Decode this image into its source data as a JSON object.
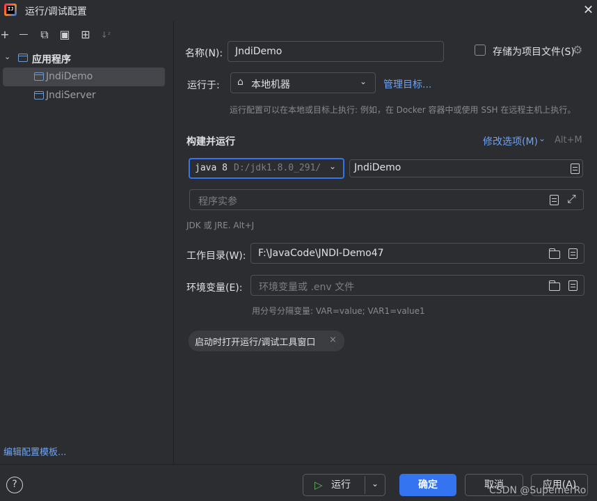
{
  "window": {
    "title": "运行/调试配置",
    "close_glyph": "✕"
  },
  "sidebar": {
    "toolbar": [
      {
        "name": "add-icon",
        "glyph": "+"
      },
      {
        "name": "remove-icon",
        "glyph": "—"
      },
      {
        "name": "copy-icon",
        "glyph": "⧉"
      },
      {
        "name": "save-icon",
        "glyph": "▣"
      },
      {
        "name": "new-folder-icon",
        "glyph": "⊞"
      },
      {
        "name": "sort-icon",
        "glyph": "↓ᶻ"
      }
    ],
    "group_label": "应用程序",
    "items": [
      {
        "label": "JndiDemo"
      },
      {
        "label": "JndiServer"
      }
    ],
    "edit_templates_link": "编辑配置模板..."
  },
  "form": {
    "name_label": "名称(N):",
    "name_value": "JndiDemo",
    "store_as_file_label": "存储为项目文件(S)",
    "run_on_label": "运行于:",
    "run_on_value": "本地机器",
    "manage_targets_link": "管理目标...",
    "run_on_hint": "运行配置可以在本地或目标上执行: 例如，在 Docker 容器中或使用 SSH 在远程主机上执行。",
    "build_run_section": "构建并运行",
    "modify_options_link": "修改选项(M)",
    "modify_options_shortcut": "Alt+M",
    "jdk_name": "java 8",
    "jdk_path": "D:/jdk1.8.0_291/",
    "main_class_value": "JndiDemo",
    "program_args_placeholder": "程序实参",
    "jdk_hint": "JDK 或 JRE. Alt+J",
    "workdir_label": "工作目录(W):",
    "workdir_value": "F:\\JavaCode\\JNDI-Demo47",
    "env_label": "环境变量(E):",
    "env_placeholder": "环境变量或 .env 文件",
    "env_hint": "用分号分隔变量: VAR=value; VAR1=value1",
    "chip_label": "启动时打开运行/调试工具窗口"
  },
  "bottom": {
    "help_glyph": "?",
    "run_label": "运行",
    "ok_label": "确定",
    "cancel_label": "取消",
    "apply_label": "应用(A)",
    "watermark": "CSDN @SupemerRo"
  },
  "colors": {
    "accent": "#3574f0",
    "link": "#6ea3f5",
    "background": "#2b2d30",
    "selection": "#43454a"
  }
}
